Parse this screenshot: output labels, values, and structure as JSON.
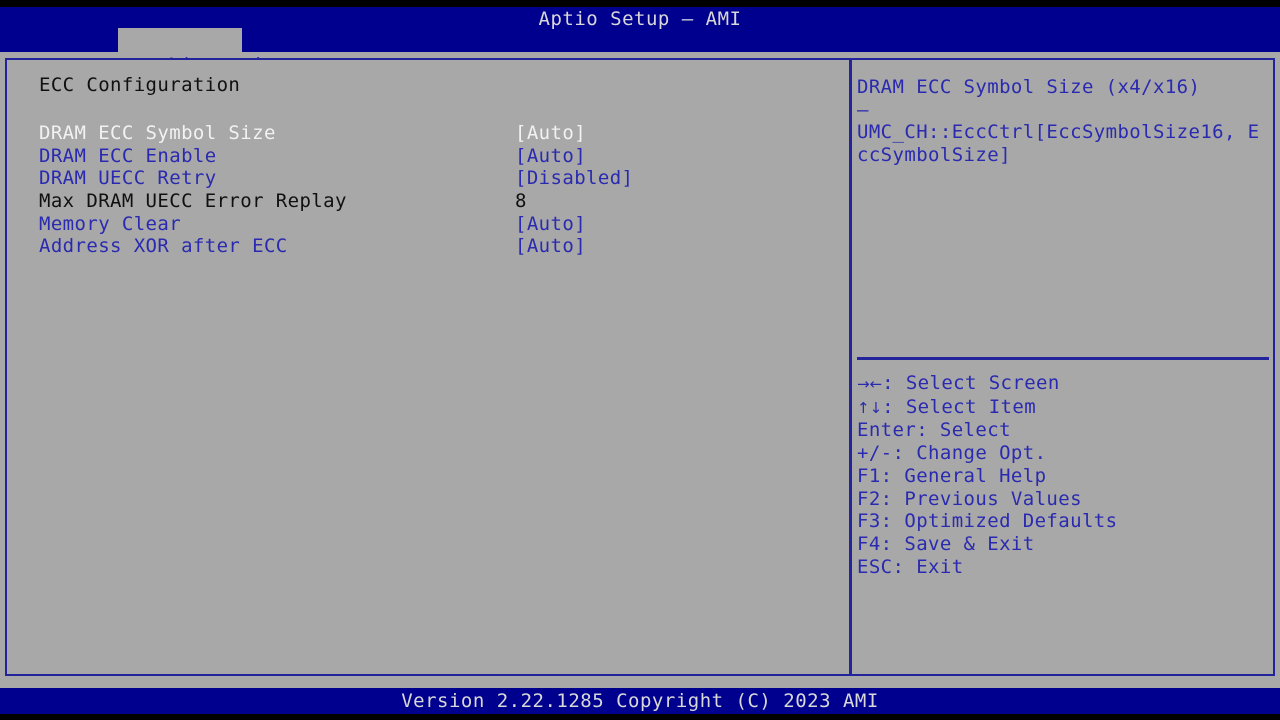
{
  "header": {
    "title": "Aptio Setup – AMI",
    "tabs": [
      {
        "label": "Advanced",
        "active": true
      }
    ]
  },
  "main": {
    "section_title": "ECC Configuration",
    "options": [
      {
        "label": "DRAM ECC Symbol Size",
        "value": "[Auto]",
        "state": "selected",
        "type": "option"
      },
      {
        "label": "DRAM ECC Enable",
        "value": "[Auto]",
        "state": "normal",
        "type": "option"
      },
      {
        "label": "DRAM UECC Retry",
        "value": "[Disabled]",
        "state": "normal",
        "type": "option"
      },
      {
        "label": "Max DRAM UECC Error Replay",
        "value": "8",
        "state": "grayed",
        "type": "numeric"
      },
      {
        "label": "Memory Clear",
        "value": "[Auto]",
        "state": "normal",
        "type": "option"
      },
      {
        "label": "Address XOR after ECC",
        "value": "[Auto]",
        "state": "normal",
        "type": "option"
      }
    ]
  },
  "help": {
    "text": "DRAM ECC Symbol Size (x4/x16)\n–\nUMC_CH::EccCtrl[EccSymbolSize16, EccSymbolSize]"
  },
  "keys": [
    {
      "glyph": "→←",
      "text": ": Select Screen"
    },
    {
      "glyph": "↑↓",
      "text": ": Select Item"
    },
    {
      "glyph": "",
      "text": "Enter: Select"
    },
    {
      "glyph": "",
      "text": "+/-: Change Opt."
    },
    {
      "glyph": "",
      "text": "F1: General Help"
    },
    {
      "glyph": "",
      "text": "F2: Previous Values"
    },
    {
      "glyph": "",
      "text": "F3: Optimized Defaults"
    },
    {
      "glyph": "",
      "text": "F4: Save & Exit"
    },
    {
      "glyph": "",
      "text": "ESC: Exit"
    }
  ],
  "footer": {
    "version_text": "Version 2.22.1285 Copyright (C) 2023 AMI"
  },
  "colors": {
    "header_blue": "#00008f",
    "panel_gray": "#a8a8a8",
    "border_blue": "#23239b",
    "text_blue": "#2a2ab0",
    "text_selected": "#f2f2f2",
    "text_dark": "#101010",
    "banner_text": "#d8d8d8"
  }
}
